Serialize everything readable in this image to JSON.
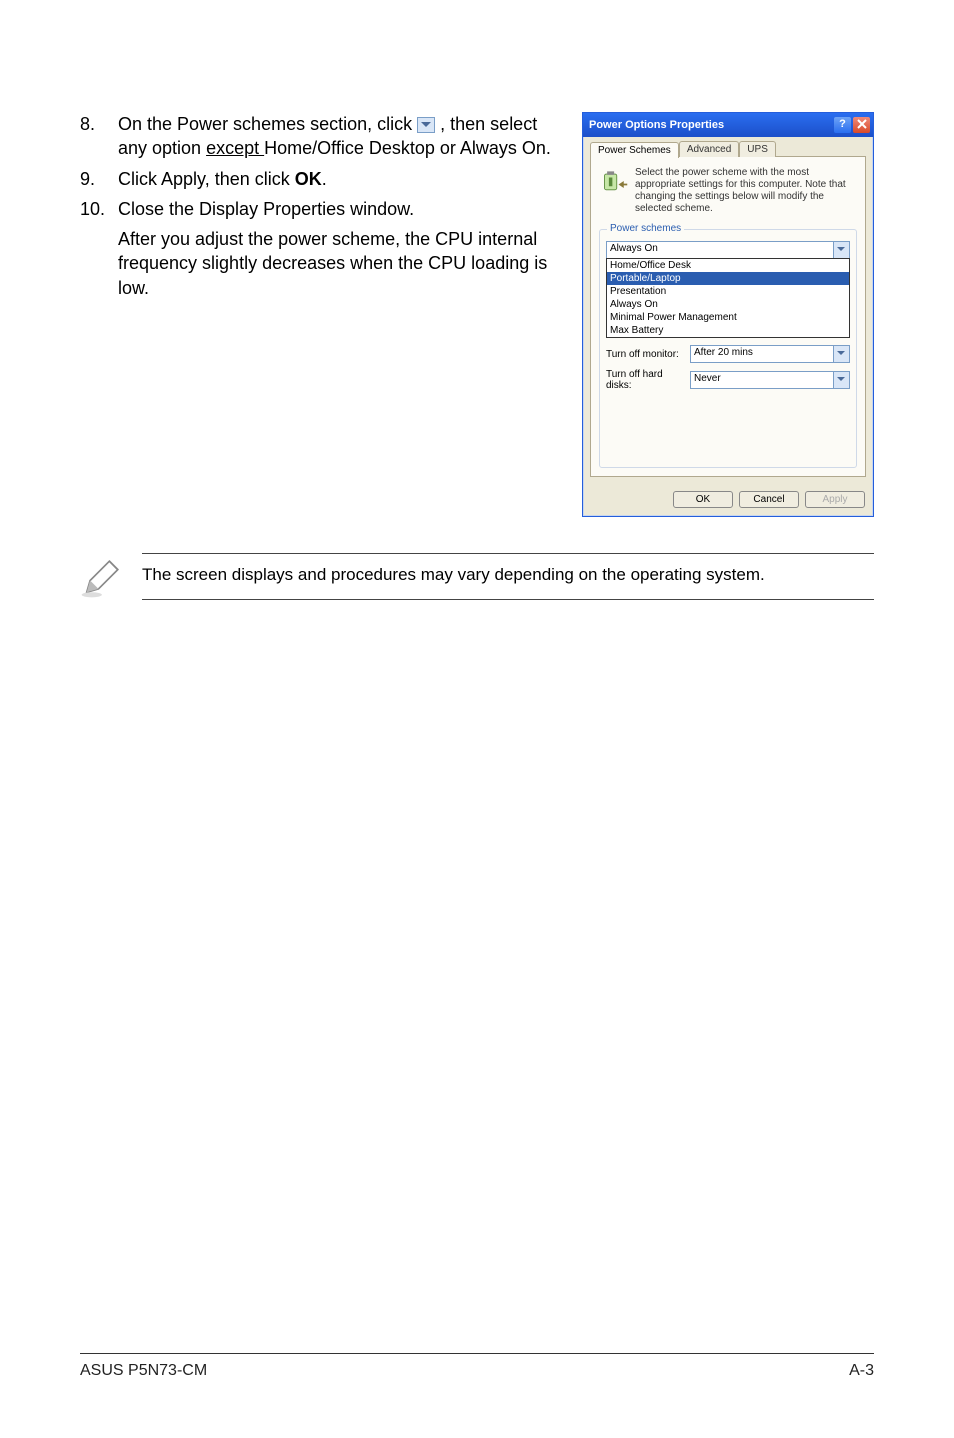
{
  "steps": {
    "n8": "8.",
    "t8a": "On the Power schemes section, click ",
    "t8b": ", then select any option ",
    "t8c_underlined": "except ",
    "t8d": "Home/Office Desktop or Always On.",
    "n9": "9.",
    "t9a": "Click Apply, then click ",
    "t9b_bold": "OK",
    "t9c": ".",
    "n10": "10.",
    "t10": "Close the Display Properties window.",
    "cont": "After you adjust the power scheme, the CPU internal frequency slightly decreases when the CPU loading is low."
  },
  "note": "The screen displays and procedures may vary depending on the operating system.",
  "dialog": {
    "title": "Power Options Properties",
    "tabs": {
      "t1": "Power Schemes",
      "t2": "Advanced",
      "t3": "UPS"
    },
    "desc": "Select the power scheme with the most appropriate settings for this computer. Note that changing the settings below will modify the selected scheme.",
    "group_label": "Power schemes",
    "combo_value": "Always On",
    "options": {
      "o1": "Home/Office Desk",
      "o2": "Portable/Laptop",
      "o3": "Presentation",
      "o4": "Always On",
      "o5": "Minimal Power Management",
      "o6": "Max Battery"
    },
    "row1_label": "Turn off monitor:",
    "row1_value": "After 20 mins",
    "row2_label": "Turn off hard disks:",
    "row2_value": "Never",
    "btn_ok": "OK",
    "btn_cancel": "Cancel",
    "btn_apply": "Apply"
  },
  "footer": {
    "left": "ASUS P5N73-CM",
    "right": "A-3"
  }
}
